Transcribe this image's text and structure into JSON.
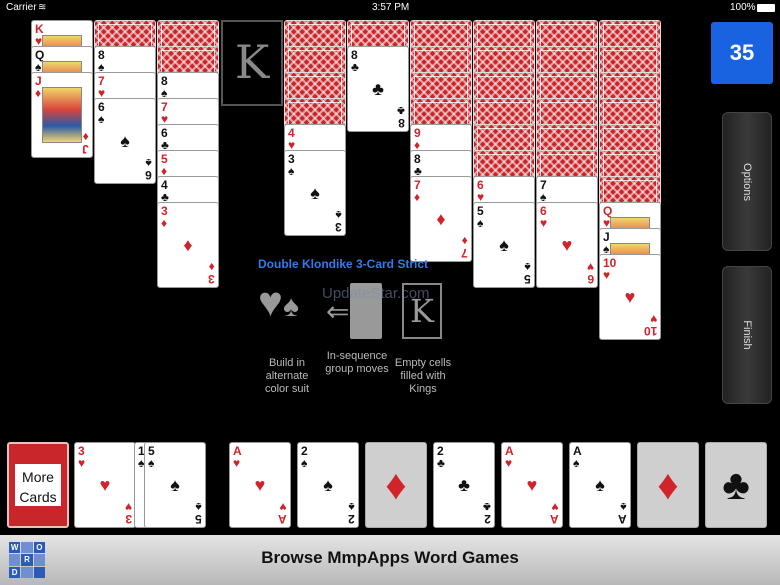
{
  "status": {
    "carrier": "Carrier",
    "time": "3:57 PM",
    "battery": "100%"
  },
  "score": "35",
  "side_buttons": {
    "options": "Options",
    "finish": "Finish"
  },
  "kings_slot_label": "K",
  "info": {
    "title": "Double Klondike 3-Card Strict",
    "hint1": "Build in alternate color suit",
    "hint2": "In-sequence group moves",
    "hint3": "Empty cells filled with Kings",
    "hint_k": "K"
  },
  "watermark": "UpdateStar.com",
  "more_cards": {
    "line1": "More",
    "line2": "Cards"
  },
  "banner": {
    "title": "Browse MmpApps Word Games",
    "logo": [
      "W",
      "",
      "O",
      "",
      "R",
      "",
      "D",
      "",
      ""
    ]
  },
  "tableau": [
    {
      "faceup": [
        "K♥",
        "Q♠",
        "J♦"
      ]
    },
    {
      "backs": 1,
      "faceup": [
        "8♠",
        "7♥",
        "6♠"
      ]
    },
    {
      "backs": 2,
      "faceup": [
        "8♠",
        "7♥",
        "6♣",
        "5♦",
        "4♣",
        "3♦"
      ]
    },
    {
      "backs": 4,
      "faceup": [
        "4♥",
        "3♠"
      ]
    },
    {
      "backs": 1,
      "faceup": [
        "8♣"
      ]
    },
    {
      "backs": 4,
      "faceup": [
        "9♦",
        "8♣",
        "7♦"
      ]
    },
    {
      "backs": 6,
      "faceup": [
        "6♥",
        "5♠"
      ]
    },
    {
      "backs": 6,
      "faceup": [
        "7♠",
        "6♥"
      ]
    },
    {
      "backs": 7,
      "faceup": [
        "Q♥",
        "J♠",
        "10♥"
      ]
    }
  ],
  "waste": [
    "3♥",
    "10♠",
    "5♠"
  ],
  "foundations": [
    "A♥",
    "2♠",
    "♦",
    "2♣",
    "A♥",
    "A♠",
    "♦",
    "♣"
  ],
  "colors": {
    "score_blue": "#1a63e0",
    "card_red": "#d0242a",
    "back_red": "#c8262a"
  }
}
